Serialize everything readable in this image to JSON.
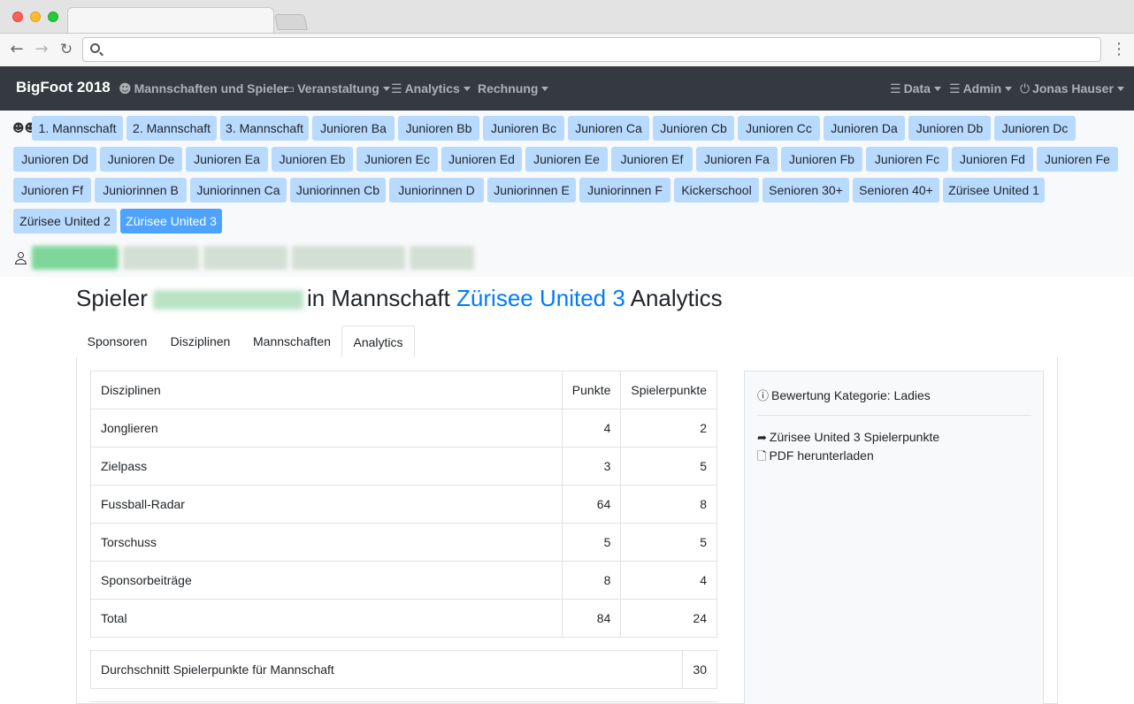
{
  "navbar": {
    "brand": "BigFoot 2018",
    "items": [
      {
        "label": "Mannschaften und Spieler",
        "icon": "teams-icon"
      },
      {
        "label": "Veranstaltung",
        "icon": "calendar-icon"
      },
      {
        "label": "Analytics",
        "icon": "list-icon"
      },
      {
        "label": "Rechnung",
        "icon": ""
      }
    ],
    "right_items": [
      {
        "label": "Data",
        "icon": "menu-icon"
      },
      {
        "label": "Admin",
        "icon": "menu-icon"
      },
      {
        "label": "Jonas Hauser",
        "icon": "power-icon"
      }
    ]
  },
  "teams": [
    "1. Mannschaft",
    "2. Mannschaft",
    "3. Mannschaft",
    "Junioren Ba",
    "Junioren Bb",
    "Junioren Bc",
    "Junioren Ca",
    "Junioren Cb",
    "Junioren Cc",
    "Junioren Da",
    "Junioren Db",
    "Junioren Dc",
    "Junioren Dd",
    "Junioren De",
    "Junioren Ea",
    "Junioren Eb",
    "Junioren Ec",
    "Junioren Ed",
    "Junioren Ee",
    "Junioren Ef",
    "Junioren Fa",
    "Junioren Fb",
    "Junioren Fc",
    "Junioren Fd",
    "Junioren Fe",
    "Junioren Ff",
    "Juniorinnen B",
    "Juniorinnen Ca",
    "Juniorinnen Cb",
    "Juniorinnen D",
    "Juniorinnen E",
    "Juniorinnen F",
    "Kickerschool",
    "Senioren 30+",
    "Senioren 40+",
    "Zürisee United 1",
    "Zürisee United 2",
    "Zürisee United 3"
  ],
  "active_team": "Zürisee United 3",
  "heading": {
    "prefix": "Spieler",
    "middle": "in Mannschaft",
    "team": "Zürisee United 3",
    "suffix": "Analytics"
  },
  "tabs": [
    "Sponsoren",
    "Disziplinen",
    "Mannschaften",
    "Analytics"
  ],
  "active_tab": "Analytics",
  "table": {
    "headers": [
      "Disziplinen",
      "Punkte",
      "Spielerpunkte"
    ],
    "rows": [
      [
        "Jonglieren",
        "4",
        "2"
      ],
      [
        "Zielpass",
        "3",
        "5"
      ],
      [
        "Fussball-Radar",
        "64",
        "8"
      ],
      [
        "Torschuss",
        "5",
        "5"
      ],
      [
        "Sponsorbeiträge",
        "8",
        "4"
      ],
      [
        "Total",
        "84",
        "24"
      ]
    ]
  },
  "average": {
    "label": "Durchschnitt Spielerpunkte für Mannschaft",
    "value": "30"
  },
  "side": {
    "title": "Bewertung Kategorie: Ladies",
    "link1": "Zürisee United 3 Spielerpunkte",
    "link2": "PDF herunterladen"
  },
  "colors": {
    "navbar": "#343a40",
    "team_button": "#b8daff",
    "team_button_active": "#4da3ff",
    "link": "#007bff"
  }
}
